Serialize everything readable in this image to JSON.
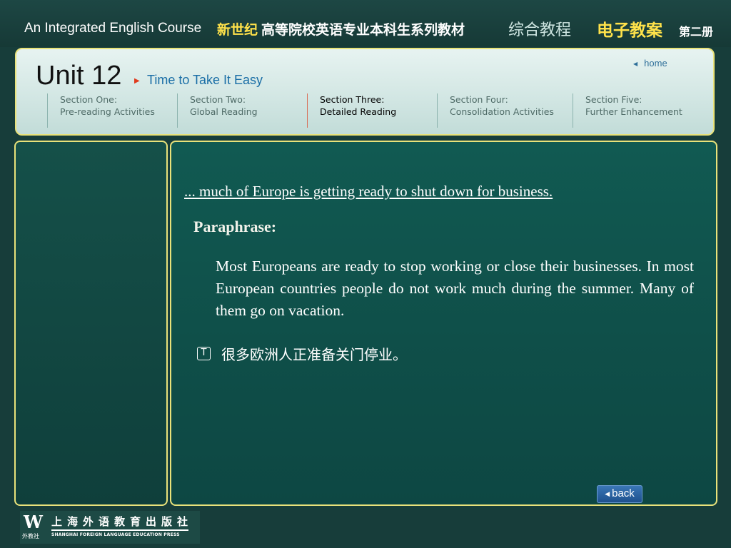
{
  "banner": {
    "course_en": "An Integrated English Course",
    "course_cn_part1": "新世纪",
    "course_cn_part2": "高等院校英语专业本科生系列教材",
    "course_cn_part3": "综合教程",
    "course_cn_part4": "电子教案",
    "course_cn_part5": "第二册"
  },
  "header": {
    "unit_title": "Unit 12",
    "unit_subtitle": "Time to Take It Easy",
    "home_label": "home",
    "sections": [
      {
        "line1": "Section One:",
        "line2": "Pre-reading Activities",
        "active": false
      },
      {
        "line1": "Section Two:",
        "line2": "Global Reading",
        "active": false
      },
      {
        "line1": "Section Three:",
        "line2": "Detailed Reading",
        "active": true
      },
      {
        "line1": "Section Four:",
        "line2": "Consolidation Activities",
        "active": false
      },
      {
        "line1": "Section Five:",
        "line2": "Further Enhancement",
        "active": false
      }
    ]
  },
  "main": {
    "quote": "... much of Europe is getting ready to shut down for business.",
    "paraphrase_label": "Paraphrase:",
    "paraphrase_text": "Most Europeans are ready to stop working or close their businesses. In most European countries people do not work much during the summer. Many of them go on vacation.",
    "translation_icon": "T",
    "translation": "很多欧洲人正准备关门停业。",
    "back_label": "back"
  },
  "footer": {
    "logo_mark": "W",
    "logo_mark_sub": "外教社",
    "publisher_cn": "上海外语教育出版社",
    "publisher_en": "SHANGHAI FOREIGN LANGUAGE EDUCATION PRESS"
  },
  "colors": {
    "accent_yellow": "#ffe24a",
    "panel_border": "#e9e27a",
    "link_blue": "#1a6ea6",
    "active_arrow": "#e03b1e"
  }
}
